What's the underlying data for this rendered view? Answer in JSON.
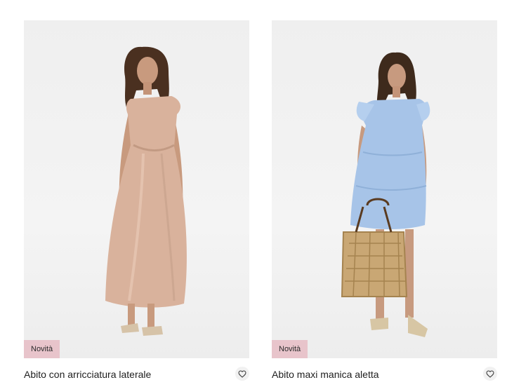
{
  "products": [
    {
      "title": "Abito con arricciatura laterale",
      "badge": "Novità",
      "image_subject": "woman-in-champagne-satin-maxi-dress"
    },
    {
      "title": "Abito maxi manica aletta",
      "badge": "Novità",
      "image_subject": "woman-in-light-blue-tiered-mini-dress-with-straw-bag"
    }
  ],
  "icons": {
    "wishlist": "heart-outline-icon"
  },
  "colors": {
    "badge_bg": "#e8c4cb",
    "photo_bg": "#f0f0f0",
    "title_text": "#1e1e1e"
  }
}
